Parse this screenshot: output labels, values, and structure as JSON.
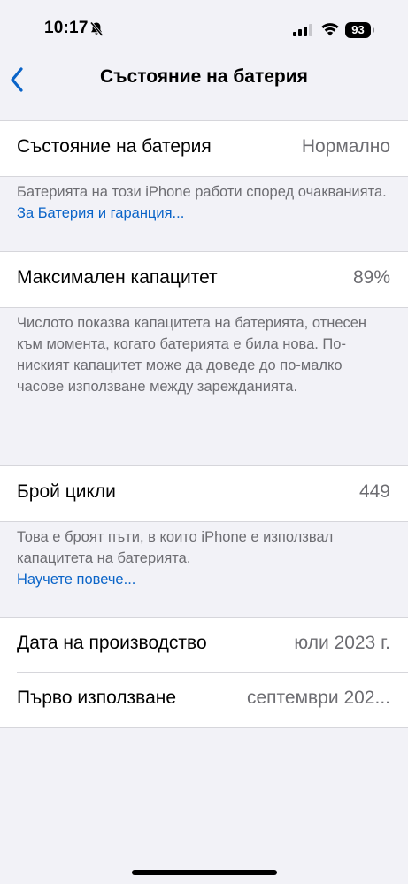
{
  "status_bar": {
    "time": "10:17",
    "battery_level": "93"
  },
  "nav": {
    "title": "Състояние на батерия"
  },
  "health": {
    "label": "Състояние на батерия",
    "value": "Нормално",
    "note": "Батерията на този iPhone работи според очакванията. ",
    "link": "За Батерия и гаранция..."
  },
  "capacity": {
    "label": "Максимален капацитет",
    "value": "89%",
    "note": "Числото показва капацитета на батерията, отнесен към момента, когато батерията е била нова. По-ниският капацитет може да доведе до по-малко часове използване между зарежданията."
  },
  "cycles": {
    "label": "Брой цикли",
    "value": "449",
    "note": "Това е броят пъти, в които iPhone е използвал капацитета на батерията.",
    "link": "Научете повече..."
  },
  "dates": {
    "manufacture_label": "Дата на производство",
    "manufacture_value": "юли 2023 г.",
    "first_use_label": "Първо използване",
    "first_use_value": "септември 202..."
  },
  "colors": {
    "accent": "#0a64c8",
    "secondary_text": "#6d6d72",
    "background": "#f2f2f7"
  }
}
